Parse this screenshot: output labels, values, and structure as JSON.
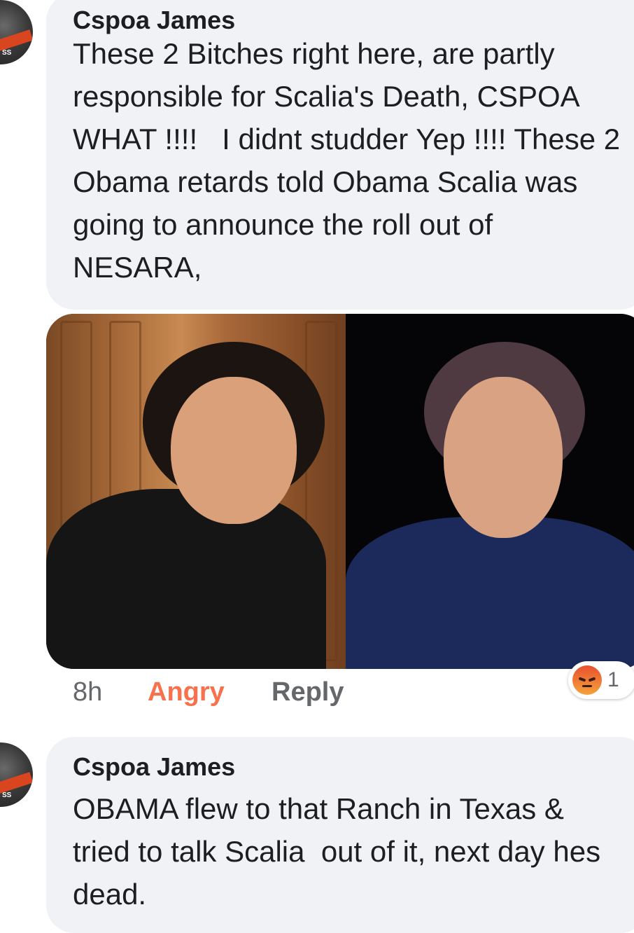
{
  "comments": [
    {
      "author": "Cspoa James",
      "text": "These 2 Bitches right here, are partly responsible for Scalia's Death, CSPOA WHAT !!!!   I didnt studder Yep !!!! These 2 Obama retards told Obama Scalia was going to announce the roll out of NESARA,",
      "time": "8h",
      "reaction_label": "Angry",
      "reply_label": "Reply",
      "reaction_count": "1",
      "reaction_icon": "angry-emoji-icon"
    },
    {
      "author": "Cspoa James",
      "text": "OBAMA flew to that Ranch in Texas & tried to talk Scalia  out of it, next day hes dead."
    }
  ],
  "colors": {
    "bubble": "#f0f2f5",
    "angry": "#f7714c",
    "meta": "#65676b"
  }
}
